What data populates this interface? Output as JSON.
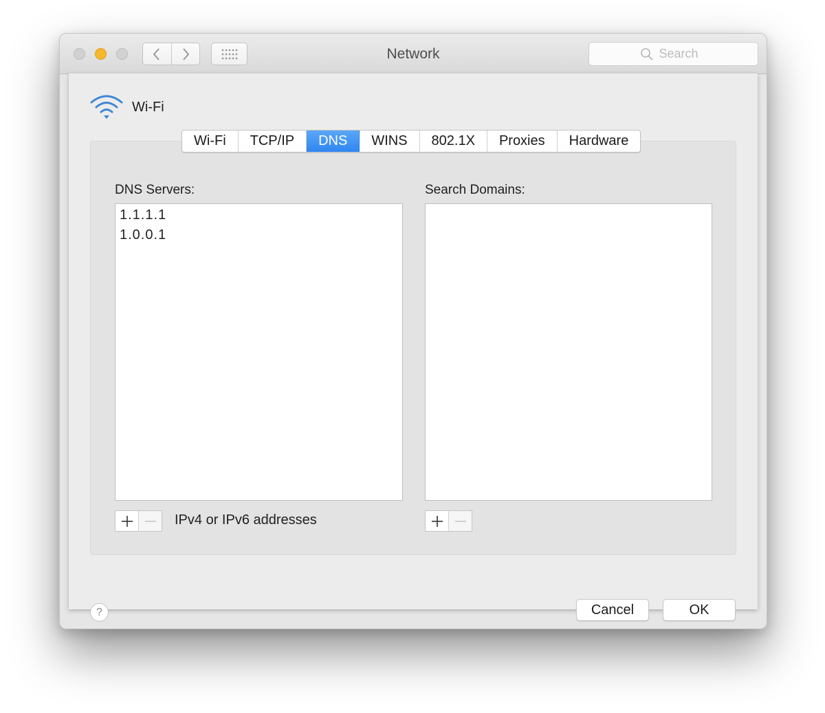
{
  "window": {
    "title": "Network",
    "search": {
      "placeholder": "Search"
    }
  },
  "service": {
    "name": "Wi-Fi",
    "icon": "wifi-icon"
  },
  "tabs": [
    "Wi-Fi",
    "TCP/IP",
    "DNS",
    "WINS",
    "802.1X",
    "Proxies",
    "Hardware"
  ],
  "active_tab": "DNS",
  "dns": {
    "label": "DNS Servers:",
    "entries": [
      "1.1.1.1",
      "1.0.0.1"
    ],
    "hint": "IPv4 or IPv6 addresses"
  },
  "search_domains": {
    "label": "Search Domains:",
    "entries": []
  },
  "buttons": {
    "help": "?",
    "cancel": "Cancel",
    "ok": "OK"
  },
  "colors": {
    "accent": "#2f86f0",
    "minimize": "#f5b82e",
    "wifi": "#3d86d6"
  }
}
